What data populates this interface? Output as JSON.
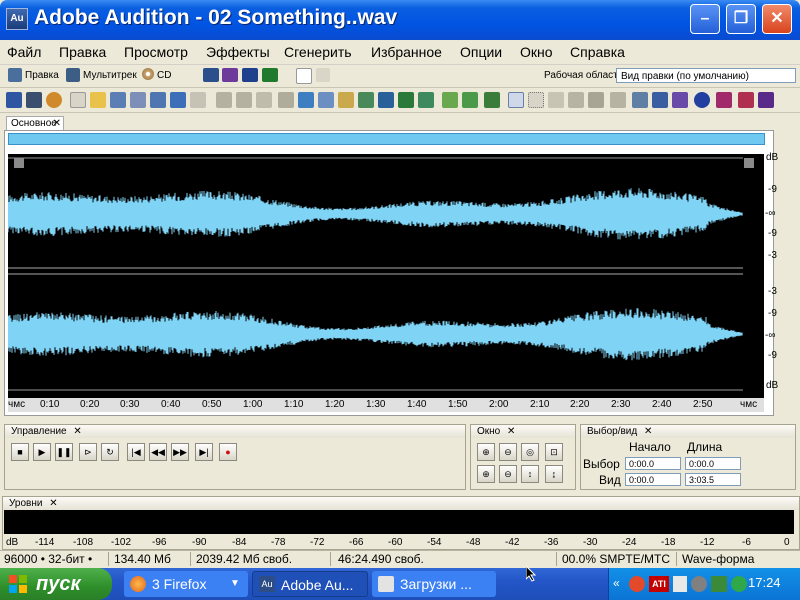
{
  "window": {
    "title": "Adobe Audition - 02 Something..wav",
    "icon": "Au"
  },
  "menu": [
    "Файл",
    "Правка",
    "Просмотр",
    "Эффекты",
    "Сгенерить",
    "Избранное",
    "Опции",
    "Окно",
    "Справка"
  ],
  "toolbar1": {
    "modes": [
      "Правка",
      "Мультитрек",
      "CD"
    ],
    "workspace_label": "Рабочая область:",
    "workspace_value": "Вид правки (по умолчанию)"
  },
  "main_panel": {
    "tab": "Основное"
  },
  "db_scale_top": [
    "dB",
    "-9",
    "-∞",
    "-9",
    "-3"
  ],
  "db_scale_bottom": [
    "-3",
    "-9",
    "-∞",
    "-9",
    "dB"
  ],
  "timeline": [
    "чмс",
    "0:10",
    "0:20",
    "0:30",
    "0:40",
    "0:50",
    "1:00",
    "1:10",
    "1:20",
    "1:30",
    "1:40",
    "1:50",
    "2:00",
    "2:10",
    "2:20",
    "2:30",
    "2:40",
    "2:50",
    "чмс"
  ],
  "transport": {
    "title": "Управление"
  },
  "zoom": {
    "title": "Окно"
  },
  "selection": {
    "title": "Выбор/вид",
    "col_start": "Начало",
    "col_length": "Длина",
    "row_selection": "Выбор",
    "row_view": "Вид",
    "sel_start": "0:00.0",
    "sel_length": "0:00.0",
    "view_start": "0:00.0",
    "view_length": "3:03.5"
  },
  "levels": {
    "title": "Уровни",
    "scale": [
      "dB",
      "-114",
      "-108",
      "-102",
      "-96",
      "-90",
      "-84",
      "-78",
      "-72",
      "-66",
      "-60",
      "-54",
      "-48",
      "-42",
      "-36",
      "-30",
      "-24",
      "-18",
      "-12",
      "-6",
      "0"
    ]
  },
  "status": {
    "format": "96000 • 32-бит •",
    "size": "134.40 Мб",
    "free": "2039.42 Мб своб.",
    "time_free": "46:24.490 своб.",
    "smpte": "00.0% SMPTE/MTC",
    "view": "Wave-форма"
  },
  "taskbar": {
    "start": "пуск",
    "tasks": [
      "3 Firefox",
      "Adobe Au...",
      "Загрузки ..."
    ],
    "clock": "17:24"
  },
  "colors": {
    "waveform": "#7fd3f5",
    "titlebar": "#0054e3",
    "start": "#3a9a36"
  }
}
